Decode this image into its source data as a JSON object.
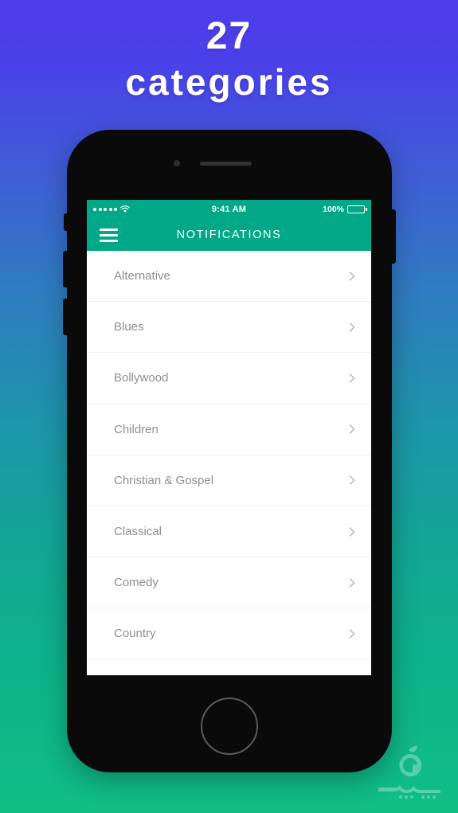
{
  "headline": {
    "number": "27",
    "word": "categories"
  },
  "colors": {
    "gradient_top": "#4f3ceb",
    "gradient_bottom": "#10be84",
    "nav_teal": "#00a887",
    "phone_body": "#0a0a0a",
    "row_label": "#8e8e8e",
    "separator": "#f0f0f0"
  },
  "phone": {
    "camera": "camera-dot",
    "speaker": "speaker-grill",
    "home_button": "home-button"
  },
  "screen": {
    "status_bar": {
      "signal_dots": 5,
      "wifi": "wifi-icon",
      "time": "9:41 AM",
      "battery_percent": "100%",
      "battery_level": 100
    },
    "nav_bar": {
      "menu_icon": "hamburger-menu-icon",
      "title": "NOTIFICATIONS"
    },
    "list": {
      "items": [
        {
          "label": "Alternative",
          "chevron": "chevron-right-icon"
        },
        {
          "label": "Blues",
          "chevron": "chevron-right-icon"
        },
        {
          "label": "Bollywood",
          "chevron": "chevron-right-icon"
        },
        {
          "label": "Children",
          "chevron": "chevron-right-icon"
        },
        {
          "label": "Christian & Gospel",
          "chevron": "chevron-right-icon"
        },
        {
          "label": "Classical",
          "chevron": "chevron-right-icon"
        },
        {
          "label": "Comedy",
          "chevron": "chevron-right-icon"
        },
        {
          "label": "Country",
          "chevron": "chevron-right-icon"
        }
      ]
    }
  },
  "watermark": {
    "name": "sibapp-logo-watermark"
  }
}
